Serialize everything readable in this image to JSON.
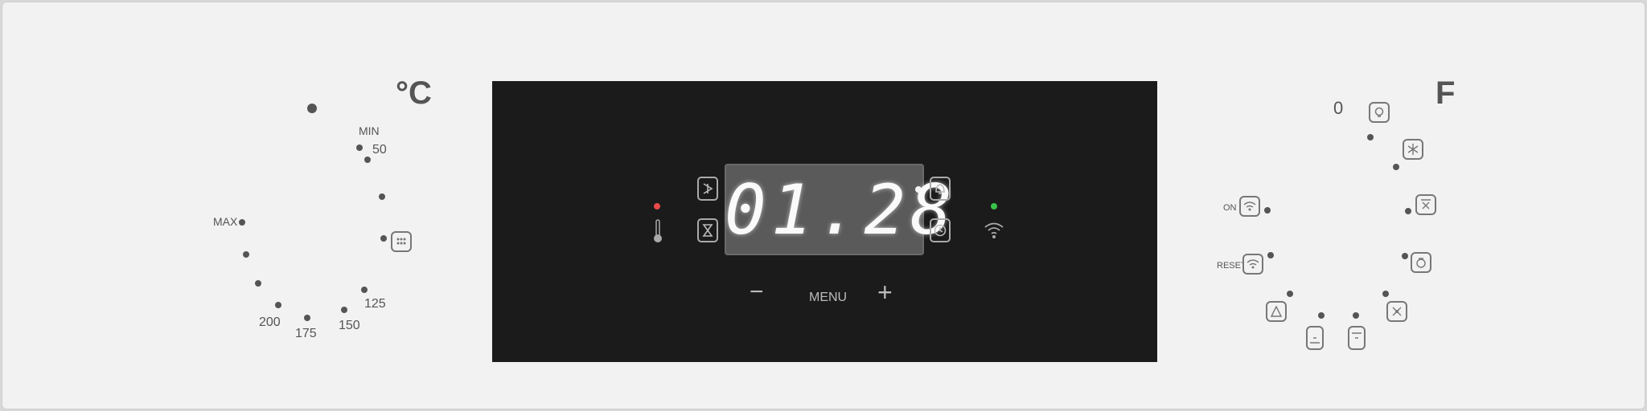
{
  "left_dial": {
    "unit": "°C",
    "min_label": "MIN",
    "max_label": "MAX",
    "scale": [
      "50",
      "125",
      "150",
      "175",
      "200"
    ]
  },
  "right_dial": {
    "unit": "F",
    "zero_label": "0",
    "on_label": "ON",
    "reset_label": "RESET",
    "icons": [
      "lamp-icon",
      "defrost-icon",
      "fan-grill-icon",
      "eco-icon",
      "fan-heat-icon",
      "bottom-heat-icon",
      "top-heat-icon",
      "pizza-icon",
      "wifi-on-icon",
      "wifi-reset-icon"
    ]
  },
  "display": {
    "time": "01.28",
    "menu_label": "MENU",
    "minus_label": "−",
    "plus_label": "+",
    "temp_led_color": "#e84a4a",
    "wifi_led_color": "#39c24a"
  }
}
